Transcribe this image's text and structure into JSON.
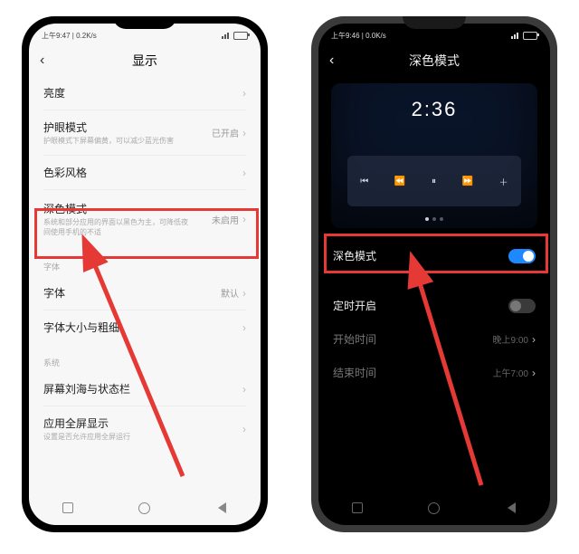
{
  "left": {
    "statusbar": {
      "time": "上午9:47 | 0.2K/s"
    },
    "title": "显示",
    "rows": {
      "brightness": {
        "label": "亮度"
      },
      "eye": {
        "label": "护眼模式",
        "sub": "护眼模式下屏幕偏黄，可以减少蓝光伤害",
        "value": "已开启"
      },
      "color": {
        "label": "色彩风格"
      },
      "darkmode": {
        "label": "深色模式",
        "sub": "系统和部分应用的界面以黑色为主，可降低夜间使用手机的不适",
        "value": "未启用"
      },
      "section_font": "字体",
      "font": {
        "label": "字体",
        "value": "默认"
      },
      "fontsize": {
        "label": "字体大小与粗细"
      },
      "section_sys": "系统",
      "notch": {
        "label": "屏幕刘海与状态栏"
      },
      "fullscreen": {
        "label": "应用全屏显示",
        "sub": "设置是否允许应用全屏运行"
      }
    }
  },
  "right": {
    "statusbar": {
      "time": "上午9:46 | 0.0K/s"
    },
    "title": "深色模式",
    "preview": {
      "clock": "2:36"
    },
    "rows": {
      "darkmode": {
        "label": "深色模式",
        "on": true
      },
      "schedule": {
        "label": "定时开启",
        "on": false
      },
      "start": {
        "label": "开始时间",
        "value": "晚上9:00"
      },
      "end": {
        "label": "结束时间",
        "value": "上午7:00"
      }
    }
  }
}
